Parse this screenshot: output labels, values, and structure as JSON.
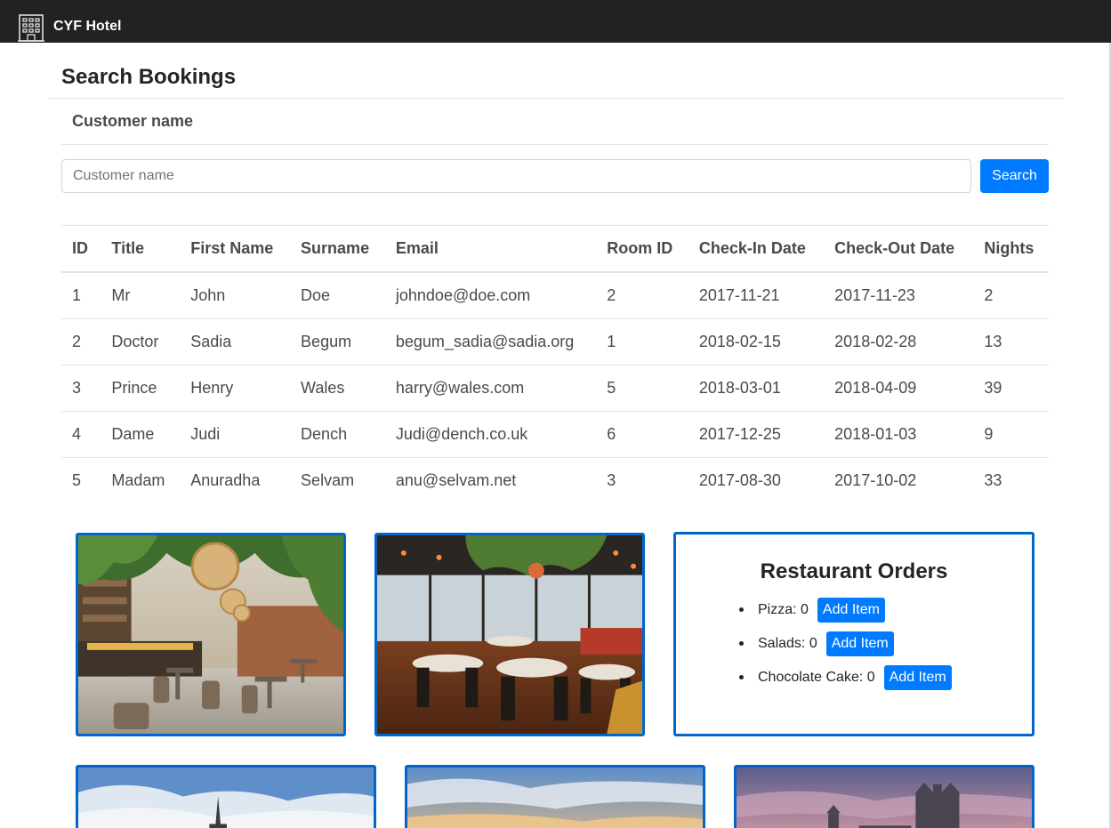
{
  "navbar": {
    "brand": "CYF Hotel",
    "logo_icon": "hotel-building-icon"
  },
  "search": {
    "title": "Search Bookings",
    "field_label": "Customer name",
    "input_value": "",
    "input_placeholder": "Customer name",
    "button_label": "Search"
  },
  "table": {
    "headers": [
      "ID",
      "Title",
      "First Name",
      "Surname",
      "Email",
      "Room ID",
      "Check-In Date",
      "Check-Out Date",
      "Nights"
    ],
    "rows": [
      [
        "1",
        "Mr",
        "John",
        "Doe",
        "johndoe@doe.com",
        "2",
        "2017-11-21",
        "2017-11-23",
        "2"
      ],
      [
        "2",
        "Doctor",
        "Sadia",
        "Begum",
        "begum_sadia@sadia.org",
        "1",
        "2018-02-15",
        "2018-02-28",
        "13"
      ],
      [
        "3",
        "Prince",
        "Henry",
        "Wales",
        "harry@wales.com",
        "5",
        "2018-03-01",
        "2018-04-09",
        "39"
      ],
      [
        "4",
        "Dame",
        "Judi",
        "Dench",
        "Judi@dench.co.uk",
        "6",
        "2017-12-25",
        "2018-01-03",
        "9"
      ],
      [
        "5",
        "Madam",
        "Anuradha",
        "Selvam",
        "anu@selvam.net",
        "3",
        "2017-08-30",
        "2017-10-02",
        "33"
      ]
    ]
  },
  "orders": {
    "title": "Restaurant Orders",
    "items": [
      {
        "name": "Pizza",
        "count_text": "Pizza: 0",
        "button_label": "Add Item"
      },
      {
        "name": "Salads",
        "count_text": "Salads: 0",
        "button_label": "Add Item"
      },
      {
        "name": "Chocolate Cake",
        "count_text": "Chocolate Cake: 0",
        "button_label": "Add Item"
      }
    ]
  },
  "colors": {
    "navbar": "#222222",
    "primary_button": "#007bff",
    "card_border": "#0066cc"
  }
}
